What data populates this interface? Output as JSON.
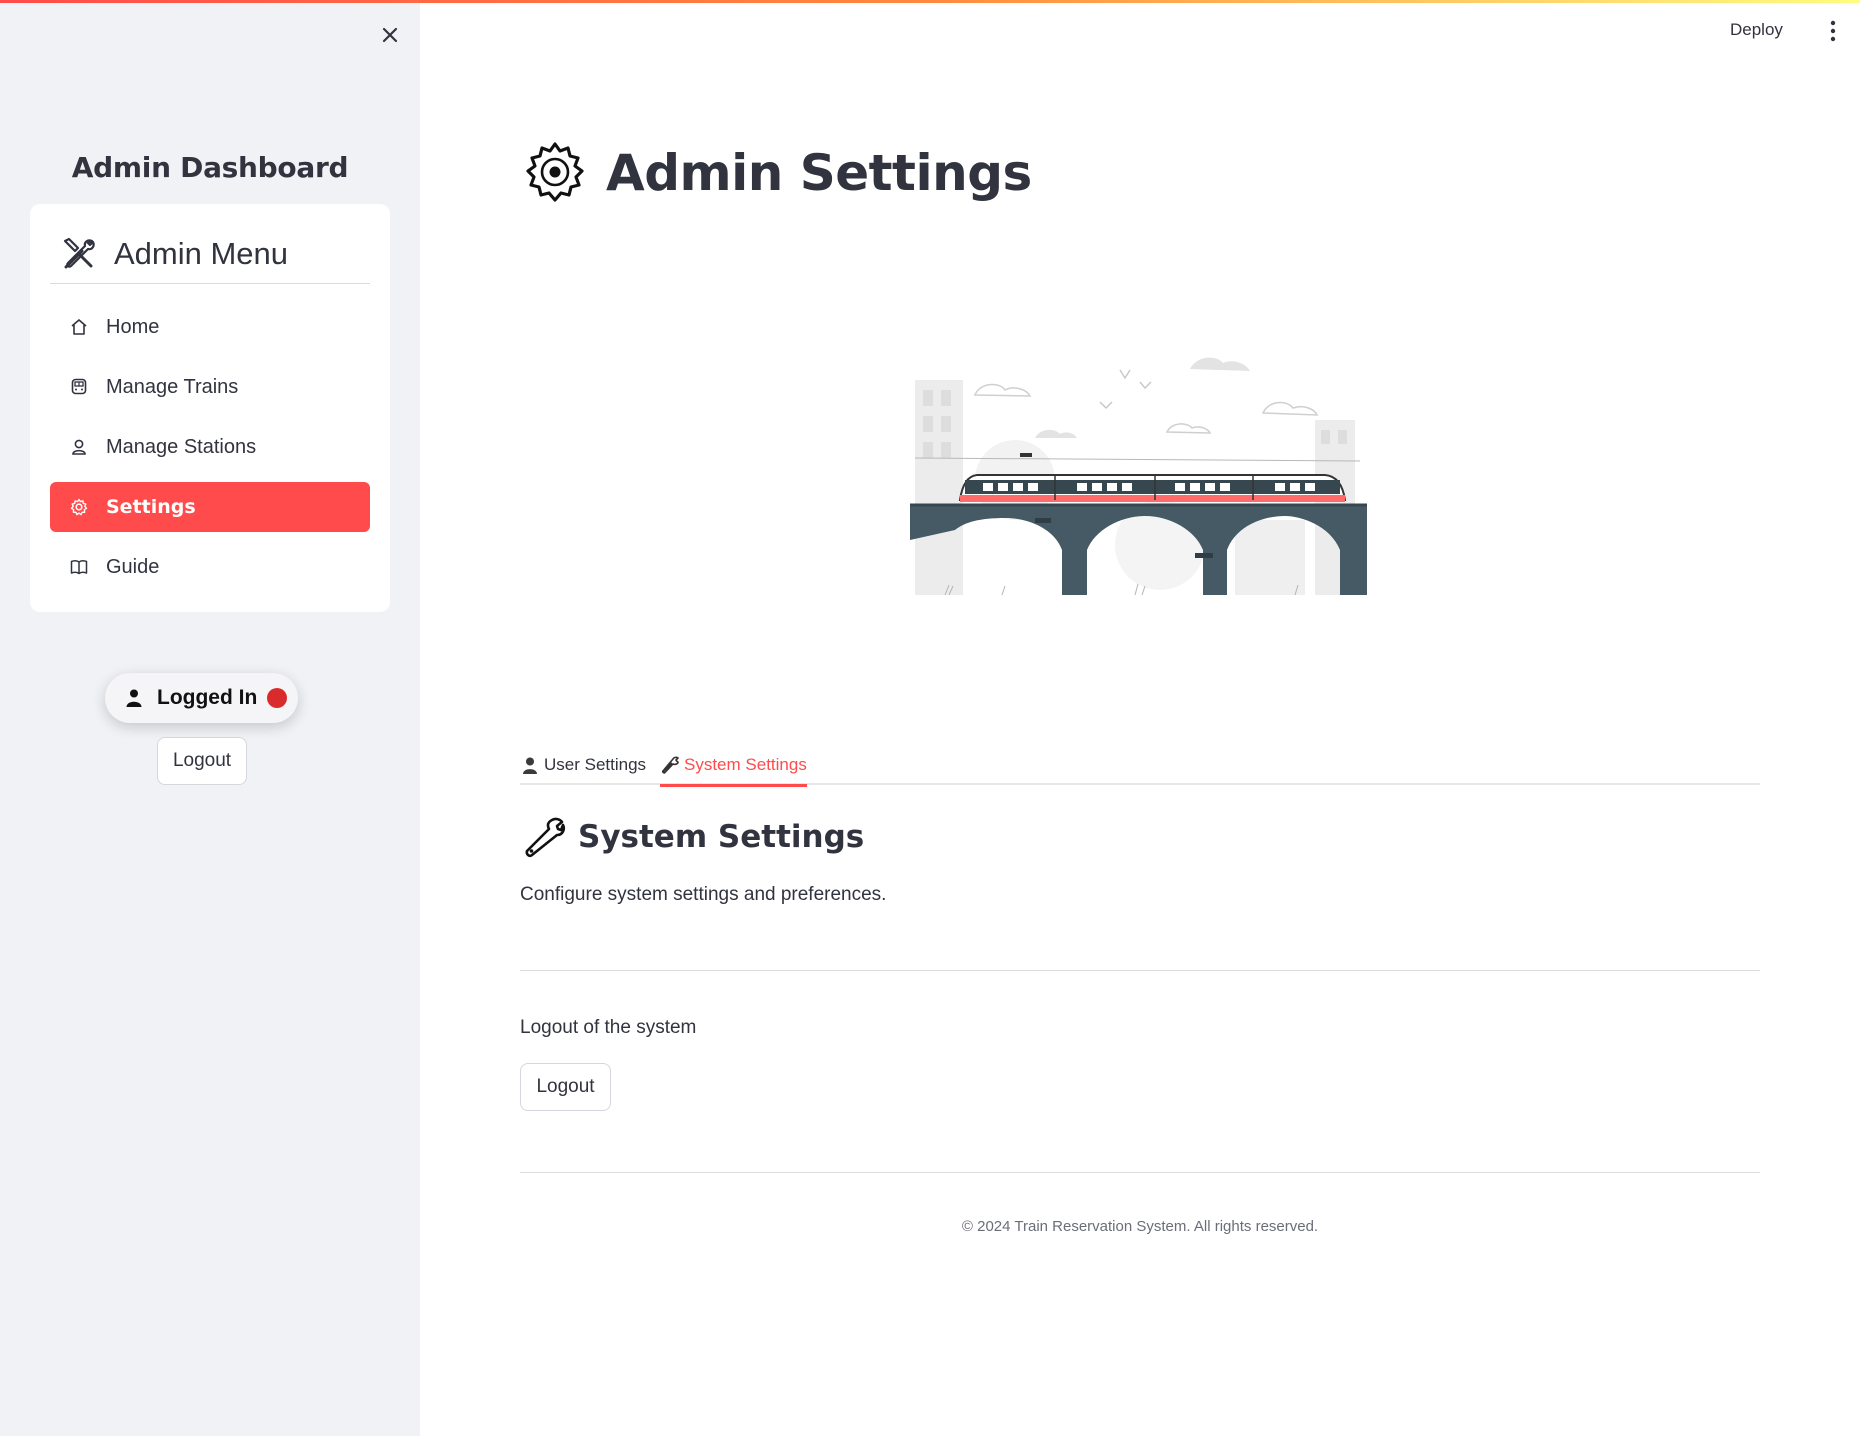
{
  "header": {
    "deploy_label": "Deploy"
  },
  "sidebar": {
    "title": "Admin Dashboard",
    "menu_title": "Admin Menu",
    "items": [
      {
        "label": "Home",
        "icon": "home-icon"
      },
      {
        "label": "Manage Trains",
        "icon": "train-icon"
      },
      {
        "label": "Manage Stations",
        "icon": "station-person-icon"
      },
      {
        "label": "Settings",
        "icon": "gear-icon",
        "active": true
      },
      {
        "label": "Guide",
        "icon": "book-icon"
      }
    ],
    "status_label": "Logged In",
    "logout_label": "Logout"
  },
  "main": {
    "title": "Admin Settings",
    "tabs": [
      {
        "label": "User Settings",
        "icon": "user-icon"
      },
      {
        "label": "System Settings",
        "icon": "wrench-icon",
        "active": true
      }
    ],
    "section_title": "System Settings",
    "section_desc": "Configure system settings and preferences.",
    "logout_text": "Logout of the system",
    "logout_label": "Logout",
    "footer": "© 2024 Train Reservation System. All rights reserved."
  },
  "colors": {
    "accent": "#ff4b4b",
    "sidebar_bg": "#f0f2f6",
    "text": "#31333f",
    "status_dot": "#d92b2b",
    "bridge": "#455a64"
  }
}
